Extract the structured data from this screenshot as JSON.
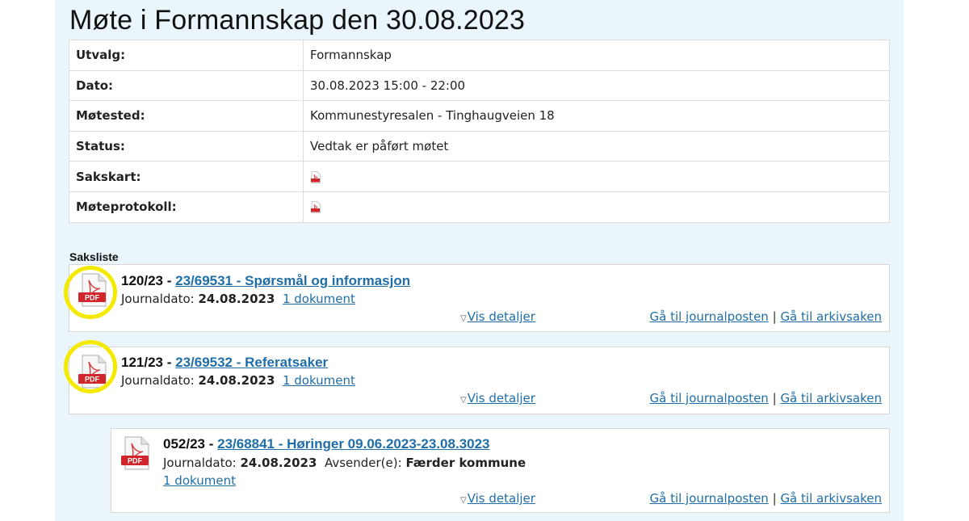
{
  "page": {
    "title": "Møte i Formannskap den 30.08.2023"
  },
  "meta": {
    "rows": [
      {
        "key": "Utvalg:",
        "value": "Formannskap"
      },
      {
        "key": "Dato:",
        "value": "30.08.2023 15:00 - 22:00"
      },
      {
        "key": "Møtested:",
        "value": "Kommunestyresalen - Tinghaugveien 18"
      },
      {
        "key": "Status:",
        "value": "Vedtak er påført møtet"
      },
      {
        "key": "Sakskart:",
        "value": ""
      },
      {
        "key": "Møteprotokoll:",
        "value": ""
      }
    ]
  },
  "saksliste": {
    "label": "Saksliste",
    "items": [
      {
        "number": "120/23",
        "dash": " - ",
        "link": "23/69531 - Spørsmål og informasjon",
        "journal_label": "Journaldato:",
        "journal_date": "24.08.2023",
        "documents": "1 dokument",
        "details": "Vis detaljer",
        "link_journal": "Gå til journalposten",
        "separator": "|",
        "link_archive": "Gå til arkivsaken"
      },
      {
        "number": "121/23",
        "dash": " - ",
        "link": "23/69532 - Referatsaker",
        "journal_label": "Journaldato:",
        "journal_date": "24.08.2023",
        "documents": "1 dokument",
        "details": "Vis detaljer",
        "link_journal": "Gå til journalposten",
        "separator": "|",
        "link_archive": "Gå til arkivsaken"
      },
      {
        "number": "052/23",
        "dash": " - ",
        "link": "23/68841 - Høringer 09.06.2023-23.08.3023",
        "journal_label": "Journaldato:",
        "journal_date": "24.08.2023",
        "sender_label": "Avsender(e):",
        "sender": "Færder kommune",
        "documents": "1 dokument",
        "details": "Vis detaljer",
        "link_journal": "Gå til journalposten",
        "separator": "|",
        "link_archive": "Gå til arkivsaken"
      }
    ]
  },
  "icons": {
    "pdf_label": "PDF",
    "highlight_color": "#f4ea00",
    "link_color": "#1f6ea8",
    "panel_color": "#eaf5fc"
  }
}
